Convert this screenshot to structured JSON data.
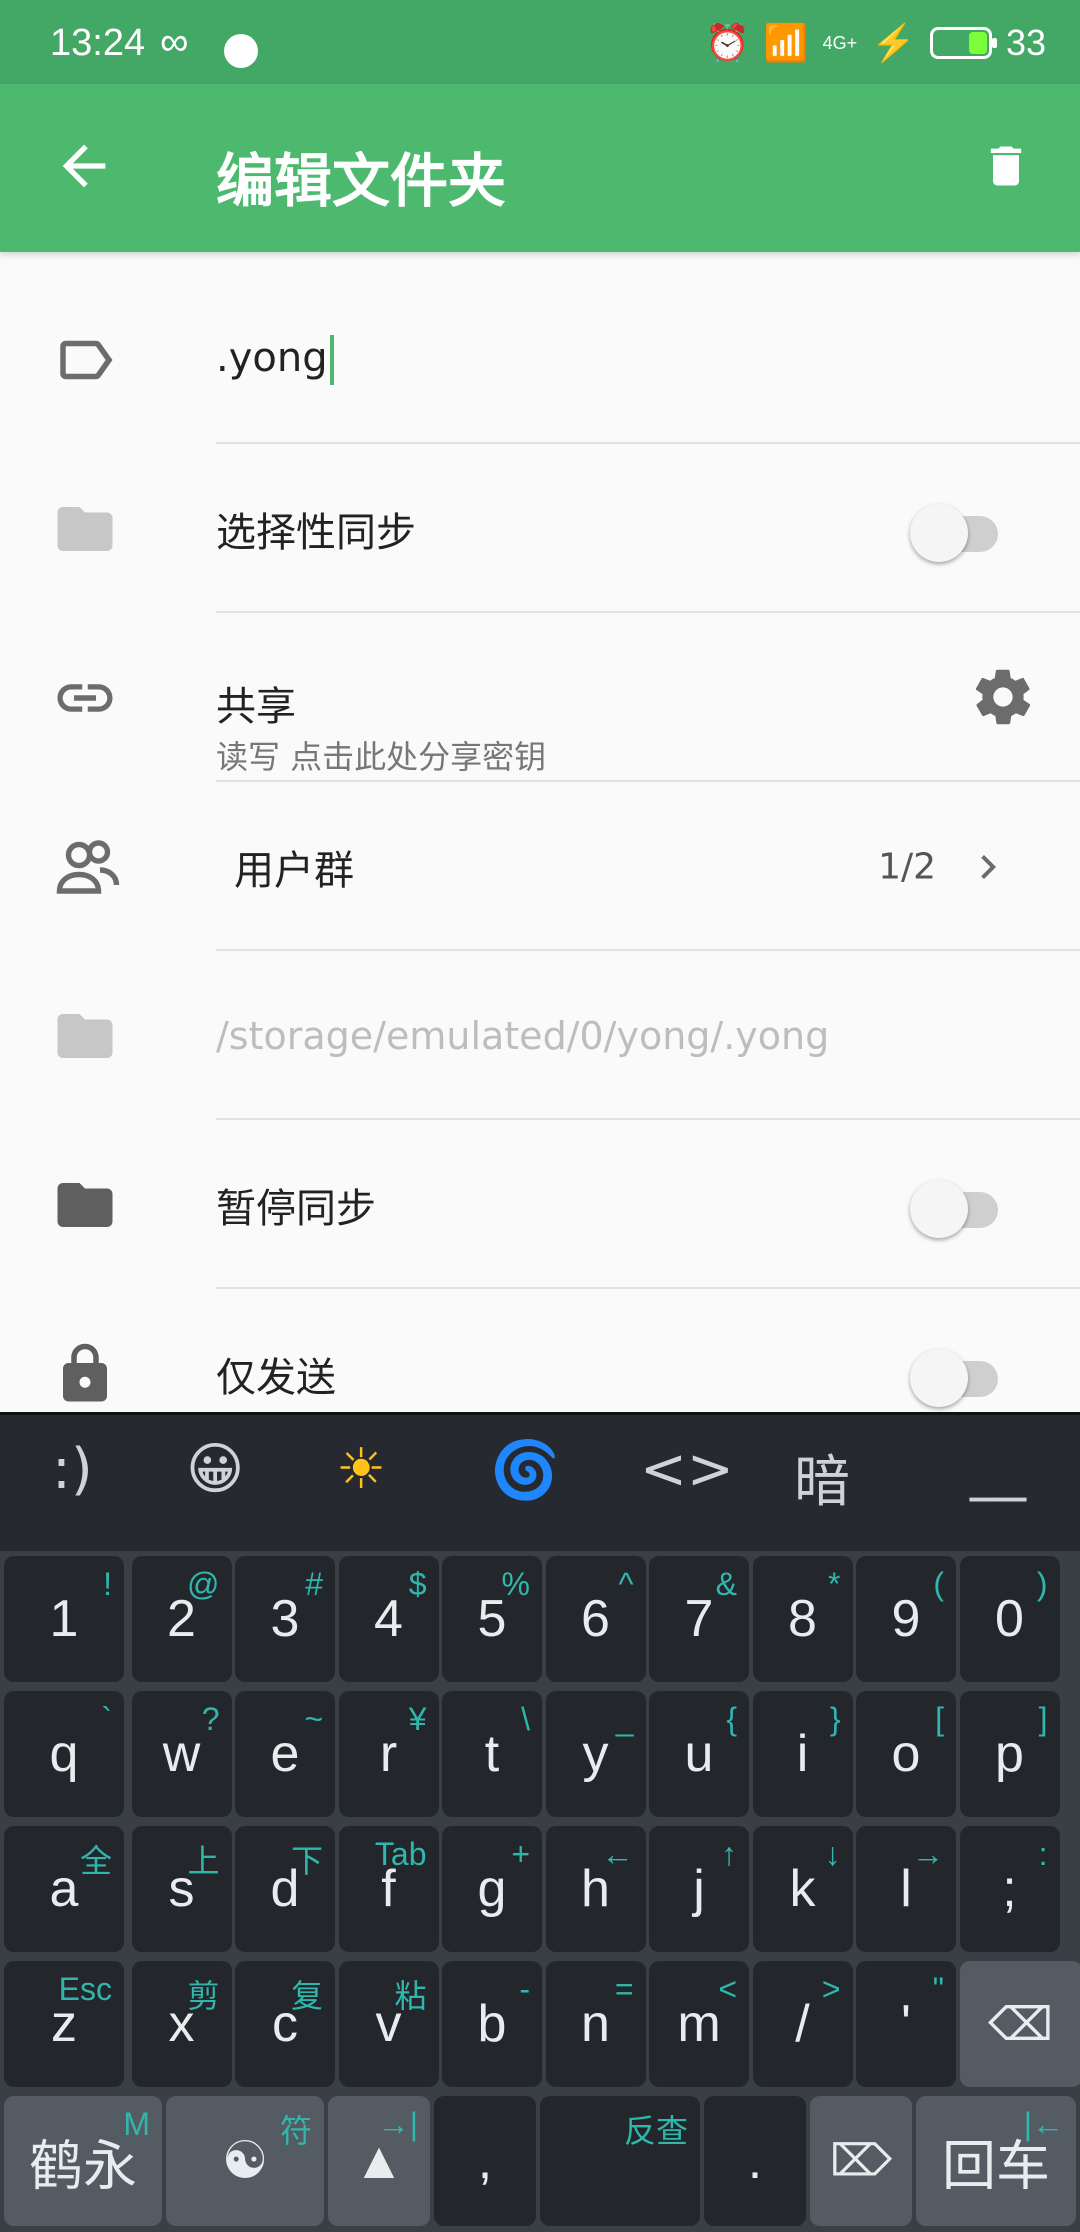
{
  "status_bar": {
    "time": "13:24",
    "network": "4G+",
    "battery": "33"
  },
  "app_bar": {
    "title": "编辑文件夹"
  },
  "folder": {
    "label_value": ".yong",
    "selective_sync": "选择性同步",
    "share_title": "共享",
    "share_sub": "读写 点击此处分享密钥",
    "user_group": "用户群",
    "user_group_count": "1/2",
    "path": "/storage/emulated/0/yong/.yong",
    "pause_sync": "暂停同步",
    "send_only": "仅发送"
  },
  "toggles": {
    "selective_sync": false,
    "pause_sync": false,
    "send_only": false
  },
  "keyboard": {
    "candidates": [
      ":)",
      "😀",
      "☀",
      "🌀",
      "<>",
      "暗",
      "__"
    ],
    "row_numbers": [
      {
        "main": "1",
        "alt": "!"
      },
      {
        "main": "2",
        "alt": "@"
      },
      {
        "main": "3",
        "alt": "#"
      },
      {
        "main": "4",
        "alt": "$"
      },
      {
        "main": "5",
        "alt": "%"
      },
      {
        "main": "6",
        "alt": "^"
      },
      {
        "main": "7",
        "alt": "&"
      },
      {
        "main": "8",
        "alt": "*"
      },
      {
        "main": "9",
        "alt": "("
      },
      {
        "main": "0",
        "alt": ")"
      }
    ],
    "row_q": [
      {
        "main": "q",
        "alt": "`"
      },
      {
        "main": "w",
        "alt": "?"
      },
      {
        "main": "e",
        "alt": "~"
      },
      {
        "main": "r",
        "alt": "¥"
      },
      {
        "main": "t",
        "alt": "\\"
      },
      {
        "main": "y",
        "alt": "_"
      },
      {
        "main": "u",
        "alt": "{"
      },
      {
        "main": "i",
        "alt": "}"
      },
      {
        "main": "o",
        "alt": "["
      },
      {
        "main": "p",
        "alt": "]"
      }
    ],
    "row_a": [
      {
        "main": "a",
        "alt": "全"
      },
      {
        "main": "s",
        "alt": "上"
      },
      {
        "main": "d",
        "alt": "下"
      },
      {
        "main": "f",
        "alt": "Tab"
      },
      {
        "main": "g",
        "alt": "+"
      },
      {
        "main": "h",
        "alt": "←"
      },
      {
        "main": "j",
        "alt": "↑"
      },
      {
        "main": "k",
        "alt": "↓"
      },
      {
        "main": "l",
        "alt": "→"
      },
      {
        "main": ";",
        "alt": ":"
      }
    ],
    "row_z": [
      {
        "main": "z",
        "alt": "Esc"
      },
      {
        "main": "x",
        "alt": "剪"
      },
      {
        "main": "c",
        "alt": "复"
      },
      {
        "main": "v",
        "alt": "粘"
      },
      {
        "main": "b",
        "alt": "-"
      },
      {
        "main": "n",
        "alt": "="
      },
      {
        "main": "m",
        "alt": "<"
      },
      {
        "main": "/",
        "alt": ">"
      },
      {
        "main": "'",
        "alt": "\""
      }
    ],
    "bottom": {
      "ime_label": "鹤永",
      "ime_alt": "M",
      "sym_alt": "符",
      "shift_alt": "→|",
      "comma": ",",
      "space_alt": "反查",
      "period": ".",
      "enter_label": "回车",
      "enter_alt": "|←"
    }
  }
}
